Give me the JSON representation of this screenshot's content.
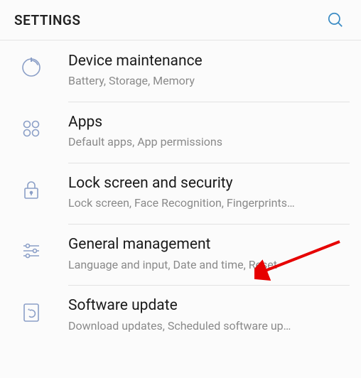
{
  "header": {
    "title": "SETTINGS"
  },
  "items": [
    {
      "title": "Device maintenance",
      "subtitle": "Battery, Storage, Memory"
    },
    {
      "title": "Apps",
      "subtitle": "Default apps, App permissions"
    },
    {
      "title": "Lock screen and security",
      "subtitle": "Lock screen, Face Recognition, Fingerprints…"
    },
    {
      "title": "General management",
      "subtitle": "Language and input, Date and time, Reset"
    },
    {
      "title": "Software update",
      "subtitle": "Download updates, Scheduled software up…"
    }
  ],
  "colors": {
    "icon": "#8b9fc7",
    "search": "#3a8bc4",
    "arrow": "#e60000"
  }
}
